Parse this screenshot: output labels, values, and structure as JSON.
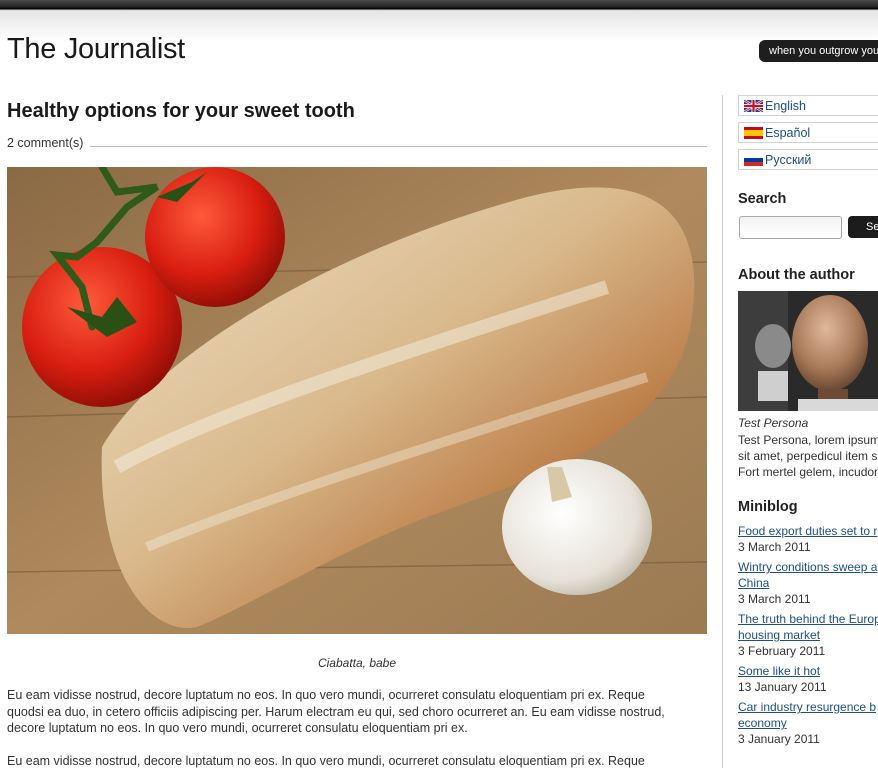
{
  "site": {
    "title": "The Journalist",
    "tagline": "when you outgrow you"
  },
  "post": {
    "title": "Healthy options for your sweet tooth",
    "comments": "2 comment(s)",
    "caption": "Ciabatta, babe",
    "paragraphs": [
      [
        "Eu eam vidisse nostrud, decore luptatum no eos. In quo vero mundi, ocurreret consulatu eloquentiam pri ex. Reque",
        "quodsi ea duo, in cetero officiis adipiscing per. Harum electram eu qui, sed choro ocurreret an. Eu eam vidisse nostrud,",
        "decore luptatum no eos. In quo vero mundi, ocurreret consulatu eloquentiam pri ex."
      ],
      [
        "Eu eam vidisse nostrud, decore luptatum no eos. In quo vero mundi, ocurreret consulatu eloquentiam pri ex. Reque"
      ]
    ]
  },
  "sidebar": {
    "languages": [
      {
        "label": "English",
        "flag": "uk-flag-icon"
      },
      {
        "label": "Español",
        "flag": "spain-flag-icon"
      },
      {
        "label": "Русский",
        "flag": "russia-flag-icon"
      }
    ],
    "search": {
      "heading": "Search",
      "button": "Se",
      "placeholder": ""
    },
    "about": {
      "heading": "About the author",
      "name": "Test Persona",
      "bio_lines": [
        "Test Persona, lorem ipsum",
        "sit amet, perpedicul item s",
        "Fort mertel gelem, incudor"
      ]
    },
    "miniblog": {
      "heading": "Miniblog",
      "items": [
        {
          "title_lines": [
            "Food export duties set to r"
          ],
          "date": "3 March 2011"
        },
        {
          "title_lines": [
            "Wintry conditions sweep a",
            "China"
          ],
          "date": "3 March 2011"
        },
        {
          "title_lines": [
            "The truth behind the Europ",
            "housing market"
          ],
          "date": "3 February 2011"
        },
        {
          "title_lines": [
            "Some like it hot"
          ],
          "date": "13 January 2011"
        },
        {
          "title_lines": [
            "Car industry resurgence b",
            "economy"
          ],
          "date": "3 January 2011"
        }
      ]
    }
  },
  "colors": {
    "link": "#1d4f8c",
    "dark_bar": "#1e1e1e"
  }
}
